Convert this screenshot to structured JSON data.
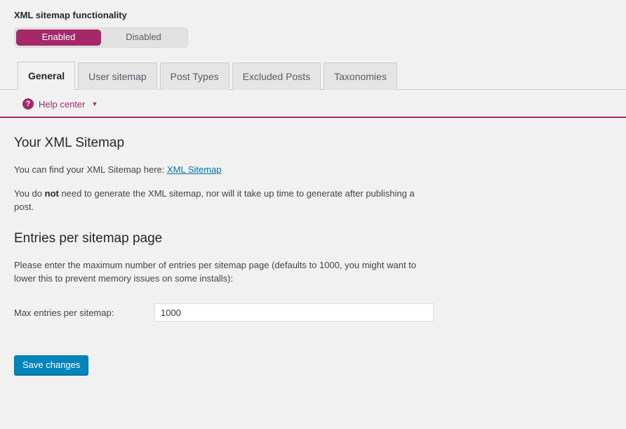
{
  "toggle": {
    "title": "XML sitemap functionality",
    "options": [
      {
        "label": "Enabled",
        "active": true
      },
      {
        "label": "Disabled",
        "active": false
      }
    ]
  },
  "tabs": [
    {
      "label": "General",
      "active": true
    },
    {
      "label": "User sitemap",
      "active": false
    },
    {
      "label": "Post Types",
      "active": false
    },
    {
      "label": "Excluded Posts",
      "active": false
    },
    {
      "label": "Taxonomies",
      "active": false
    }
  ],
  "help": {
    "icon": "question-mark-icon",
    "label": "Help center",
    "chevron": "▼"
  },
  "sections": {
    "sitemap": {
      "heading": "Your XML Sitemap",
      "intro_prefix": "You can find your XML Sitemap here: ",
      "link_label": "XML Sitemap",
      "note_part1": "You do ",
      "note_bold": "not",
      "note_part2": " need to generate the XML sitemap, nor will it take up time to generate after publishing a post."
    },
    "entries": {
      "heading": "Entries per sitemap page",
      "description": "Please enter the maximum number of entries per sitemap page (defaults to 1000, you might want to lower this to prevent memory issues on some installs):",
      "field_label": "Max entries per sitemap:",
      "field_value": "1000",
      "field_placeholder": ""
    }
  },
  "actions": {
    "save_label": "Save changes"
  },
  "colors": {
    "accent_magenta": "#a4286a",
    "link_blue": "#0073aa",
    "button_blue": "#0085ba",
    "page_background": "#f1f1f1"
  }
}
